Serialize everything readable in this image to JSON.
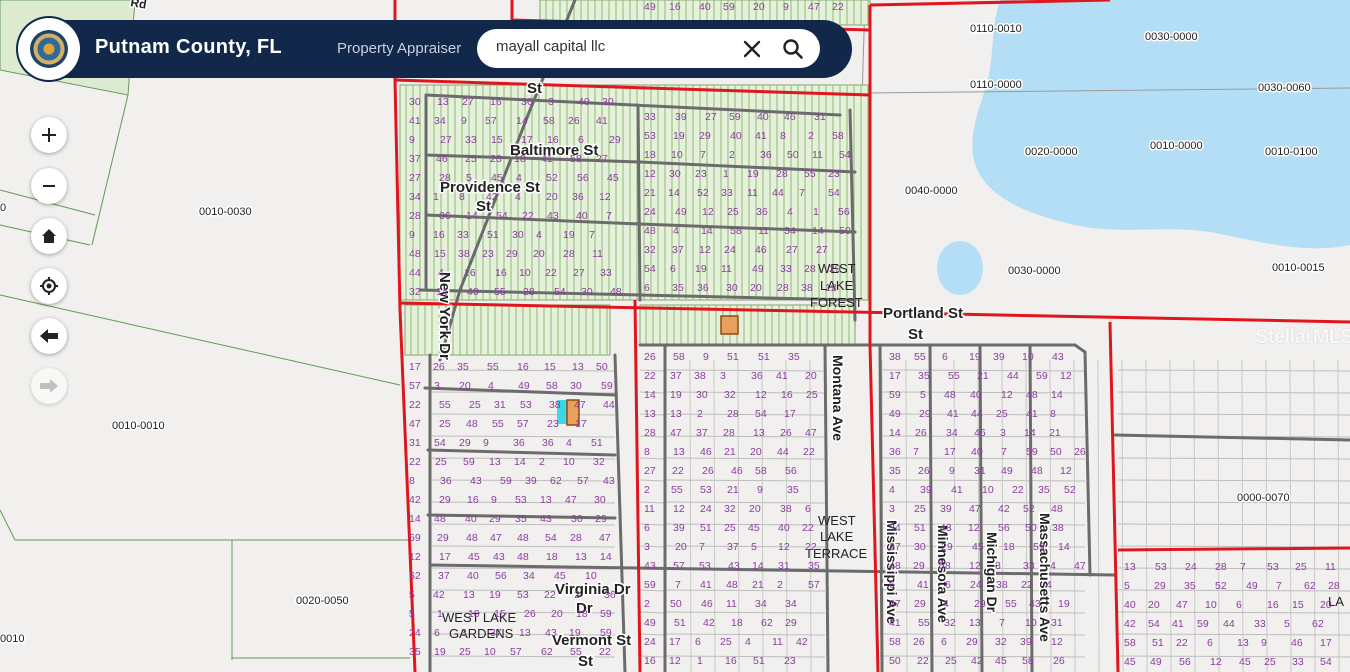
{
  "header": {
    "title": "Putnam County, FL",
    "subtitle": "Property Appraiser"
  },
  "search": {
    "value": "mayall capital llc"
  },
  "controls": [
    {
      "name": "zoom-in-icon",
      "label": "zoom in"
    },
    {
      "name": "zoom-out-icon",
      "label": "zoom out"
    },
    {
      "name": "home-icon",
      "label": "home"
    },
    {
      "name": "locate-icon",
      "label": "locate"
    },
    {
      "name": "back-arrow-icon",
      "label": "back"
    },
    {
      "name": "forward-arrow-icon",
      "label": "forward"
    }
  ],
  "watermark": "StellarMLS",
  "colors": {
    "header_bg": "#12284a",
    "water": "#b3def5",
    "parcel_green": "#a6cf8f",
    "boundary_red": "#e0161e",
    "road_gray": "#6b6b6b",
    "lot_numbers": "#8b3d9e",
    "highlight_orange": "#d9914a",
    "highlight_cyan": "#28d5e6"
  },
  "streets": [
    "Baltimore St",
    "Providence St",
    "New York Dr",
    "Portland St",
    "Montana Ave",
    "Mississippi Ave",
    "Minnesota Ave",
    "Michigan Dr",
    "Massachusetts Ave",
    "Virginia Dr",
    "Vermont St",
    "St",
    "Rd"
  ],
  "subdivisions": [
    "WEST LAKE FOREST",
    "WEST LAKE TERRACE",
    "WEST LAKE GARDENS",
    "LA"
  ],
  "parcel_ids": [
    "0110-0010",
    "0030-0000",
    "0110-0000",
    "0030-0060",
    "0020-0000",
    "0010-0000",
    "0010-0100",
    "0040-0000",
    "0030-0000",
    "0010-0015",
    "0010-0030",
    "0010-0010",
    "0000-0070",
    "0020-0050",
    "0010",
    "0"
  ],
  "lot_numbers": {
    "a": [
      "20",
      "22",
      "18",
      "19",
      "16",
      "12",
      "13",
      "14",
      "25",
      "15",
      "9",
      "10",
      "8",
      "7",
      "6",
      "5",
      "4",
      "3",
      "2",
      "1",
      "11",
      "17",
      "24",
      "21",
      "23",
      "26",
      "27",
      "28",
      "29",
      "30",
      "31",
      "32",
      "33",
      "34",
      "35",
      "36",
      "37",
      "38",
      "39",
      "40",
      "41",
      "42",
      "43",
      "44",
      "45",
      "46",
      "47",
      "48",
      "49",
      "50",
      "51",
      "52",
      "53",
      "54",
      "55",
      "56",
      "57",
      "58",
      "59",
      "62"
    ]
  }
}
